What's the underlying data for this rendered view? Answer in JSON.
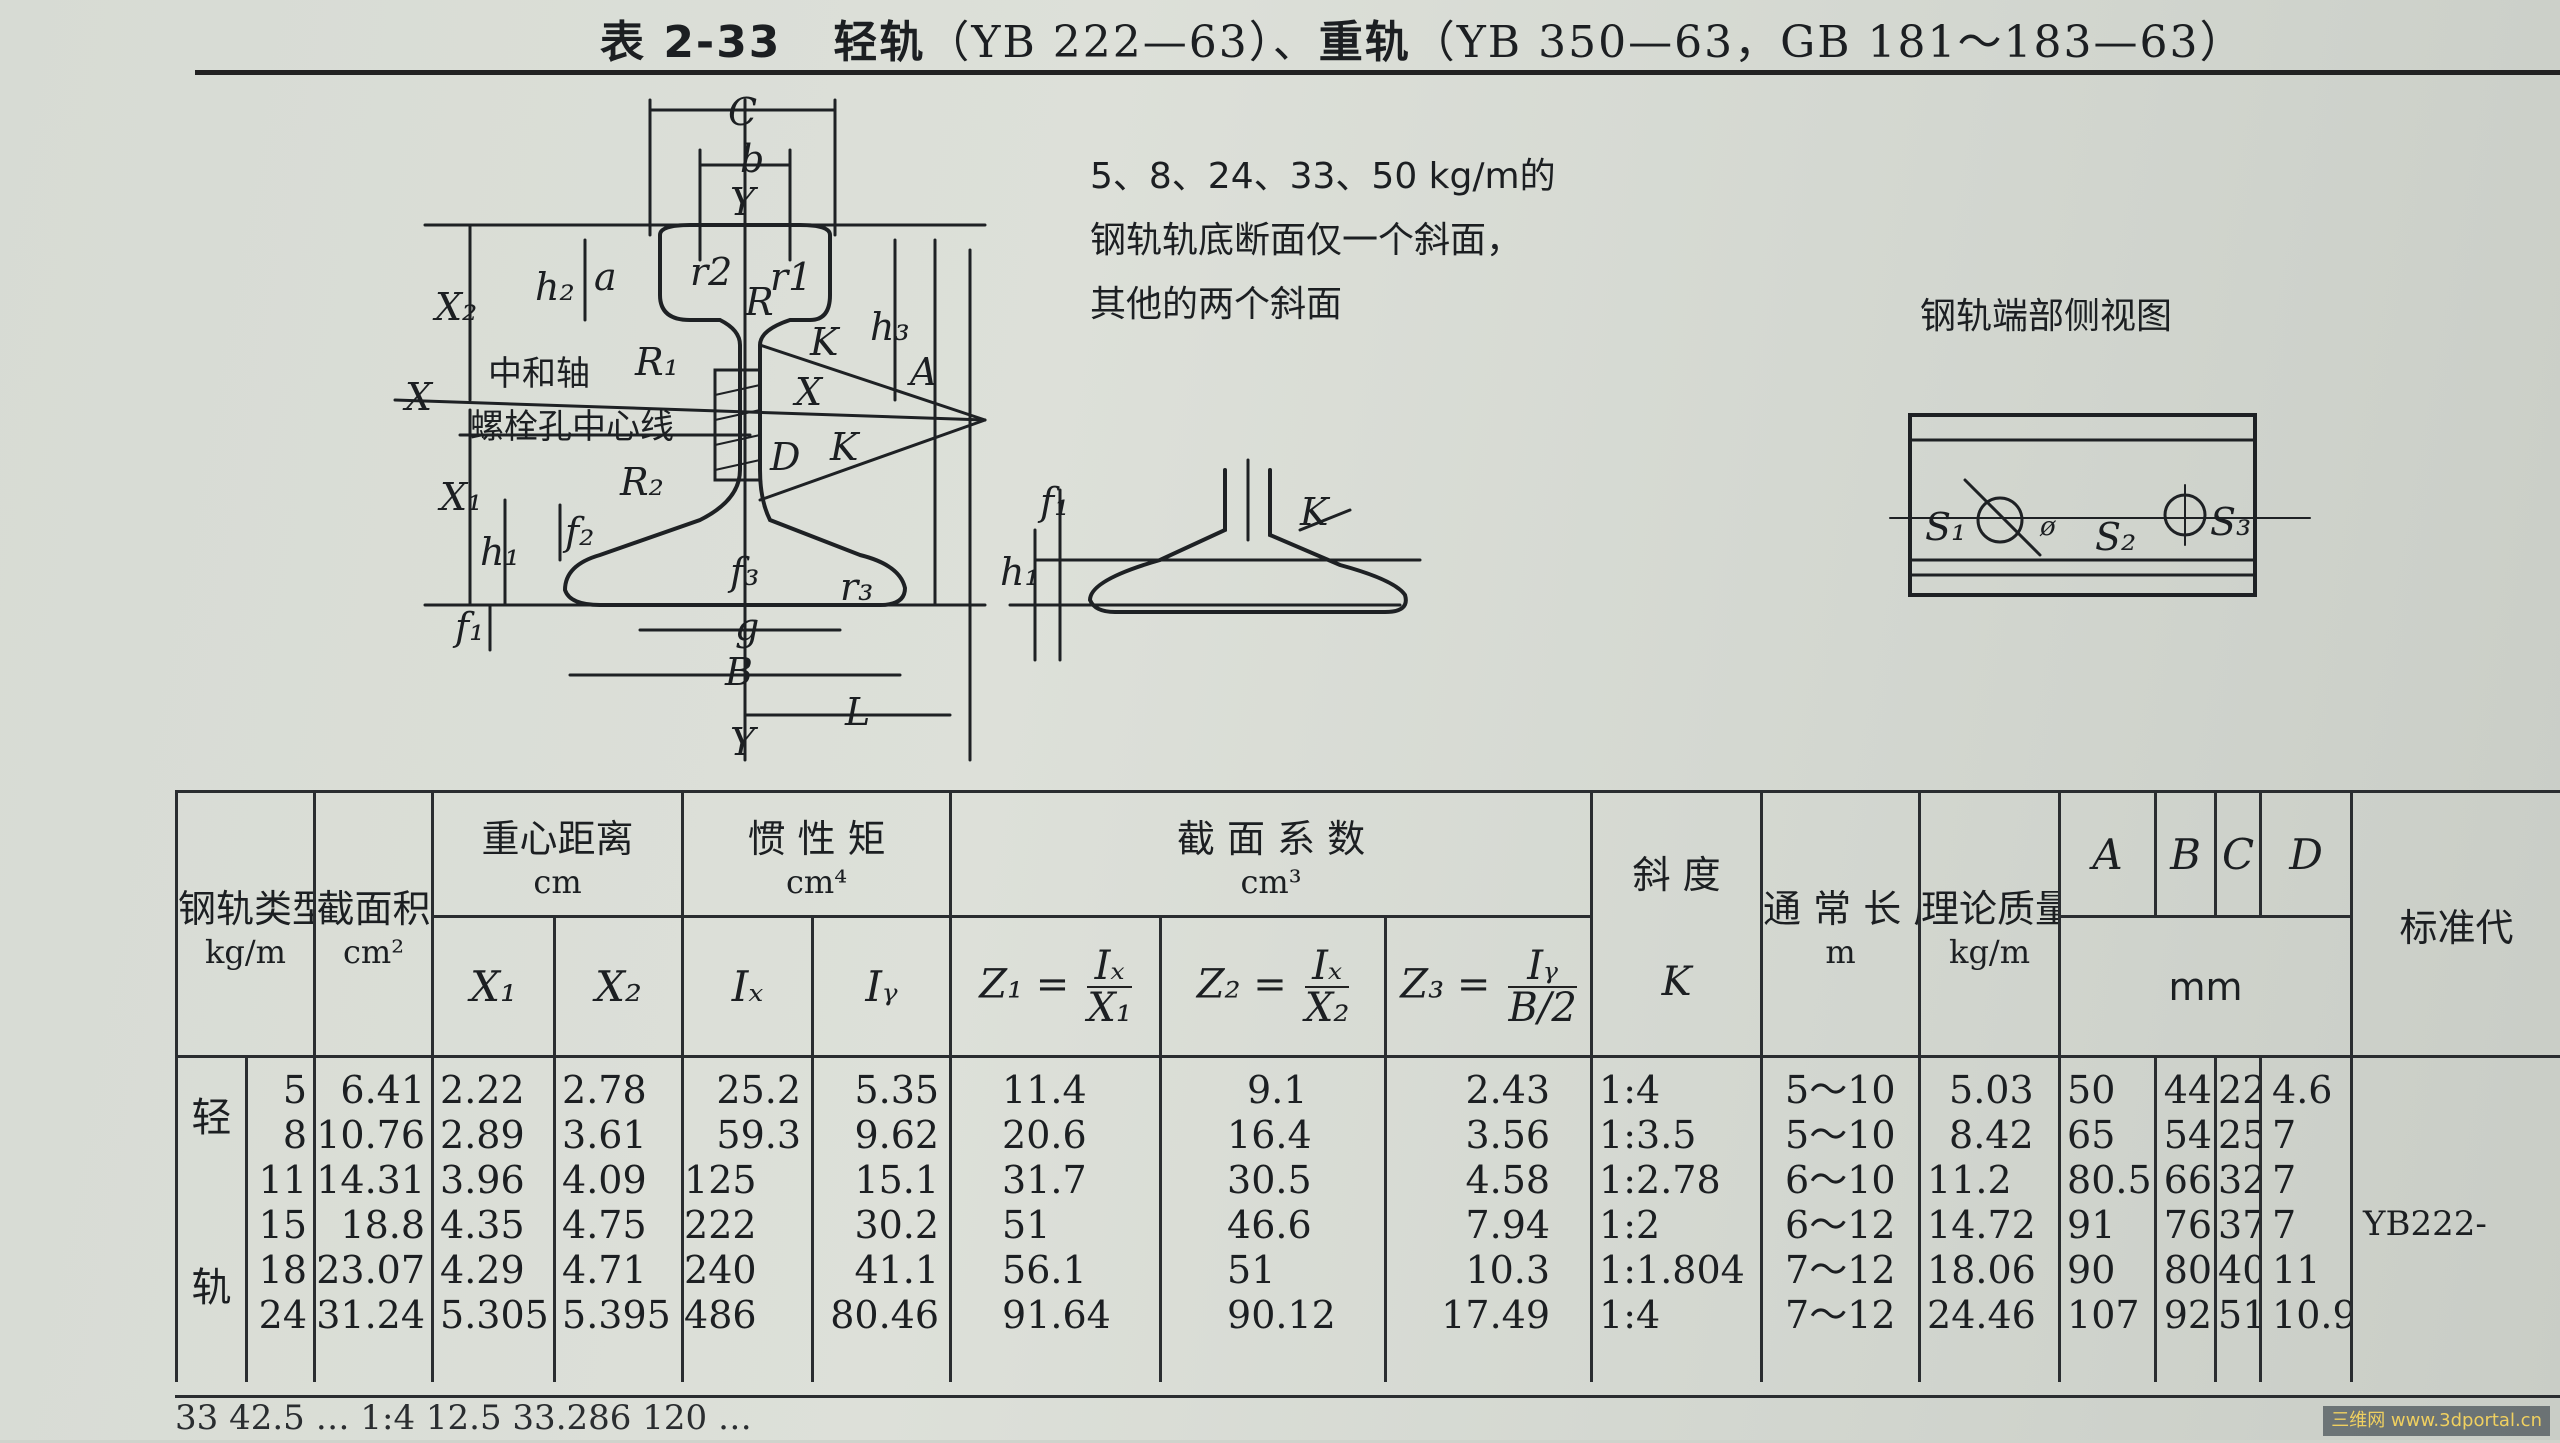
{
  "title": {
    "table_no": "表 2-33",
    "light_rail": "轻轨",
    "light_std": "（YB 222—63）、",
    "heavy_rail": "重轨",
    "heavy_std": "（YB 350—63，GB 181～183—63）"
  },
  "diagram": {
    "labels": {
      "C": "C",
      "b": "b",
      "Y": "Y",
      "a": "a",
      "h2": "h₂",
      "X2": "X₂",
      "r2": "r2",
      "r1": "r1",
      "R": "R",
      "h3": "h₃",
      "A": "A",
      "K": "K",
      "neutral_axis": "中和轴",
      "X": "X",
      "R1": "R₁",
      "bolt_hole_line": "螺栓孔中心线",
      "D": "D",
      "R2": "R₂",
      "X1": "X₁",
      "f2": "f₂",
      "h1": "h₁",
      "f3": "f₃",
      "f1": "f₁",
      "g": "g",
      "r3": "r₃",
      "B": "B",
      "L": "L"
    },
    "note_lines": [
      "5、8、24、33、50 kg/m的",
      "钢轨轨底断面仅一个斜面，",
      "其他的两个斜面"
    ],
    "end_view_title": "钢轨端部侧视图",
    "end_view_labels": {
      "S1": "S₁",
      "S2": "S₂",
      "S3": "S₃",
      "phi": "ø"
    }
  },
  "table": {
    "headers": {
      "rail_type": "钢轨类型",
      "rail_type_unit": "kg/m",
      "area": "截面积",
      "area_unit": "cm²",
      "centroid": "重心距离",
      "centroid_unit": "cm",
      "x1": "X₁",
      "x2": "X₂",
      "inertia": "惯 性 矩",
      "inertia_unit": "cm⁴",
      "ix": "Iₓ",
      "iy": "Iᵧ",
      "modulus": "截 面 系 数",
      "modulus_unit": "cm³",
      "z1_lhs": "Z₁ =",
      "z1_num": "Iₓ",
      "z1_den": "X₁",
      "z2_lhs": "Z₂ =",
      "z2_num": "Iₓ",
      "z2_den": "X₂",
      "z3_lhs": "Z₃ =",
      "z3_num": "Iᵧ",
      "z3_den": "B/2",
      "slope": "斜 度",
      "slope_var": "K",
      "length": "通 常 长 度",
      "length_unit": "m",
      "mass": "理论质量",
      "mass_unit": "kg/m",
      "dimA": "A",
      "dimB": "B",
      "dimC": "C",
      "dimD": "D",
      "dim_unit": "mm",
      "standard": "标准代"
    },
    "group_label": "轻 轨",
    "group_top": "轻",
    "group_bottom": "轨",
    "standard_code": "YB222-",
    "rows": [
      {
        "type": "5",
        "area": "6.41",
        "x1": "2.22",
        "x2": "2.78",
        "ix": "25.2",
        "iy": "5.35",
        "z1": "11.4",
        "z2": "9.1",
        "z3": "2.43",
        "k": "1:4",
        "len": "5～10",
        "mass": "5.03",
        "a": "50",
        "b": "44",
        "c": "22",
        "d": "4.6"
      },
      {
        "type": "8",
        "area": "10.76",
        "x1": "2.89",
        "x2": "3.61",
        "ix": "59.3",
        "iy": "9.62",
        "z1": "20.6",
        "z2": "16.4",
        "z3": "3.56",
        "k": "1:3.5",
        "len": "5～10",
        "mass": "8.42",
        "a": "65",
        "b": "54",
        "c": "25",
        "d": "7"
      },
      {
        "type": "11",
        "area": "14.31",
        "x1": "3.96",
        "x2": "4.09",
        "ix": "125",
        "iy": "15.1",
        "z1": "31.7",
        "z2": "30.5",
        "z3": "4.58",
        "k": "1:2.78",
        "len": "6～10",
        "mass": "11.2",
        "a": "80.5",
        "b": "66",
        "c": "32",
        "d": "7"
      },
      {
        "type": "15",
        "area": "18.8",
        "x1": "4.35",
        "x2": "4.75",
        "ix": "222",
        "iy": "30.2",
        "z1": "51",
        "z2": "46.6",
        "z3": "7.94",
        "k": "1:2",
        "len": "6～12",
        "mass": "14.72",
        "a": "91",
        "b": "76",
        "c": "37",
        "d": "7"
      },
      {
        "type": "18",
        "area": "23.07",
        "x1": "4.29",
        "x2": "4.71",
        "ix": "240",
        "iy": "41.1",
        "z1": "56.1",
        "z2": "51",
        "z3": "10.3",
        "k": "1:1.804",
        "len": "7～12",
        "mass": "18.06",
        "a": "90",
        "b": "80",
        "c": "40",
        "d": "11"
      },
      {
        "type": "24",
        "area": "31.24",
        "x1": "5.305",
        "x2": "5.395",
        "ix": "486",
        "iy": "80.46",
        "z1": "91.64",
        "z2": "90.12",
        "z3": "17.49",
        "k": "1:4",
        "len": "7～12",
        "mass": "24.46",
        "a": "107",
        "b": "92",
        "c": "51",
        "d": "10.9"
      }
    ],
    "next_row_partial": "33  42.5  …  1:4  12.5  33.286  120 …"
  },
  "watermark": "三维网 www.3dportal.cn"
}
